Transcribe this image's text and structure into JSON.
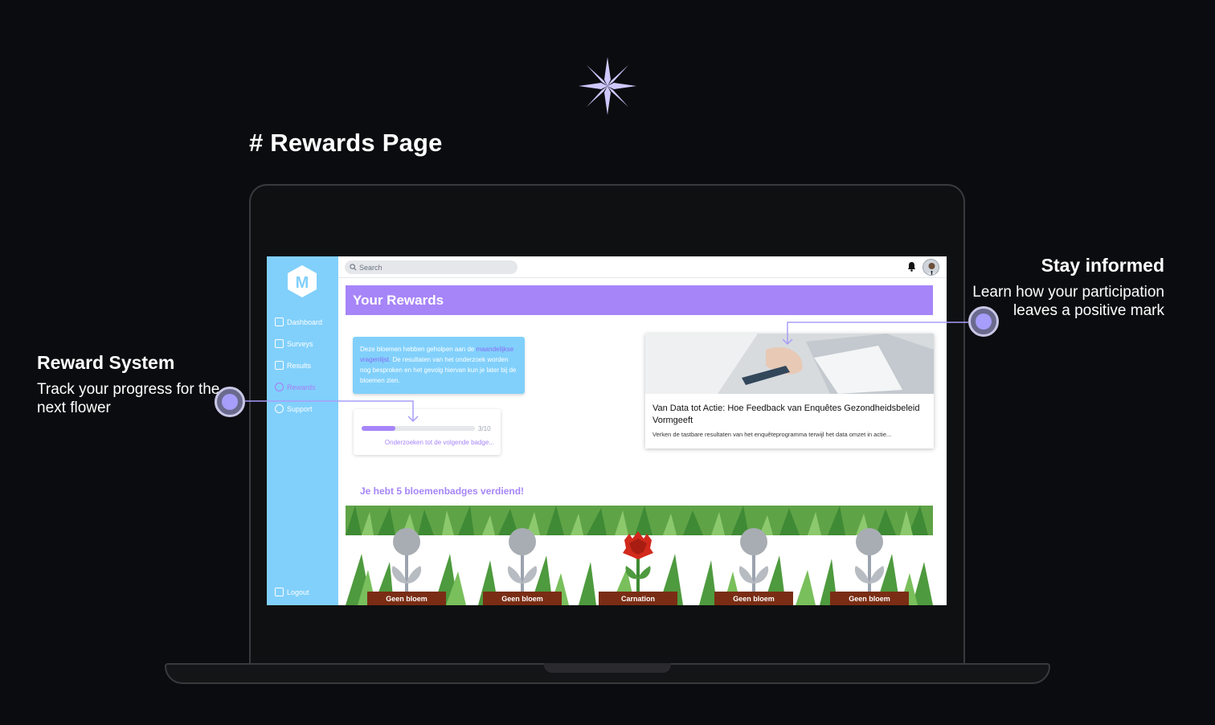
{
  "page_heading": "# Rewards Page",
  "annotations": {
    "left": {
      "title": "Reward System",
      "text": "Track your progress for the next flower"
    },
    "right": {
      "title": "Stay informed",
      "text": "Learn how your participation leaves a positive mark"
    }
  },
  "app": {
    "logo_letter": "M",
    "sidebar": {
      "items": [
        {
          "label": "Dashboard",
          "icon": "layout-icon"
        },
        {
          "label": "Surveys",
          "icon": "clipboard-icon"
        },
        {
          "label": "Results",
          "icon": "chart-icon"
        },
        {
          "label": "Rewards",
          "icon": "ribbon-icon",
          "active": true
        },
        {
          "label": "Support",
          "icon": "lifebuoy-icon"
        }
      ],
      "logout_label": "Logout"
    },
    "topbar": {
      "search_placeholder": "Search"
    },
    "banner_title": "Your Rewards",
    "info_card": {
      "text_before": "Deze bloemen hebben geholpen aan de ",
      "link": "maandelijkse vragenlijst.",
      "text_after": " De resultaten van het onderzoek worden nog besproken en het gevolg hiervan kun je later bij de bloemen zien."
    },
    "progress": {
      "count_label": "3/10",
      "fraction": 0.3,
      "caption": "Onderzoeken tot de volgende badge..."
    },
    "article": {
      "title": "Van Data tot Actie: Hoe Feedback van Enquêtes Gezondheidsbeleid Vormgeeft",
      "description": "Verken de tastbare resultaten van het enquêteprogramma terwijl het data omzet in actie..."
    },
    "badges_heading": "Je hebt 5 bloemenbadges verdiend!",
    "flowers": [
      {
        "label": "Geen bloem",
        "earned": false
      },
      {
        "label": "Geen bloem",
        "earned": false
      },
      {
        "label": "Carnation",
        "earned": true
      },
      {
        "label": "Geen bloem",
        "earned": false
      },
      {
        "label": "Geen bloem",
        "earned": false
      }
    ],
    "colors": {
      "sidebar": "#81d0fb",
      "accent_purple": "#a685f9",
      "pot": "#7a2d14",
      "carnation": "#d1291c"
    }
  }
}
